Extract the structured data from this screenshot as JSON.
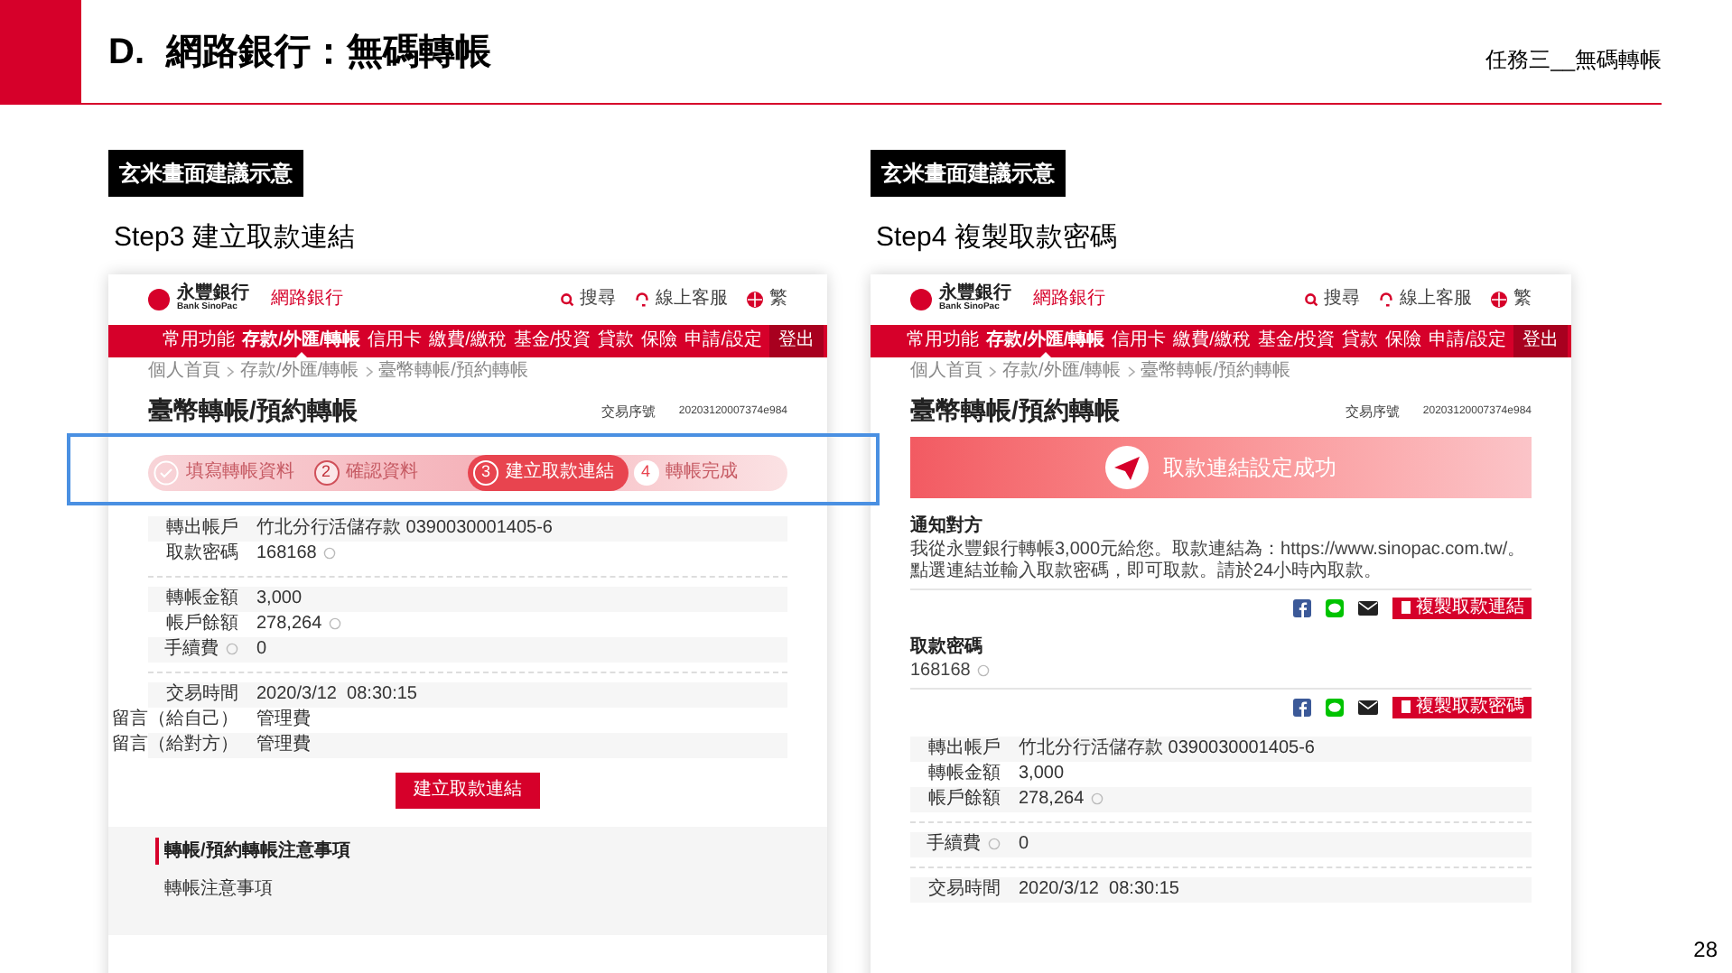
{
  "slide": {
    "section": "D.",
    "title": "網路銀行：無碼轉帳",
    "subtitle": "任務三__無碼轉帳",
    "page_number": "28"
  },
  "panels": [
    {
      "kind": "step3",
      "badge": "玄米畫面建議示意",
      "step_title": "Step3 建立取款連結",
      "highlighted": true,
      "screen": {
        "logo_name": "永豐銀行",
        "logo_en": "Bank SinoPac",
        "product": "網路銀行",
        "links": [
          {
            "kind": "search",
            "label": "搜尋"
          },
          {
            "kind": "support",
            "label": "線上客服"
          },
          {
            "kind": "language",
            "label": "繁"
          }
        ],
        "nav": [
          {
            "label": "常用功能",
            "selected": false
          },
          {
            "label": "存款/外匯/轉帳",
            "selected": true
          },
          {
            "label": "信用卡",
            "selected": false
          },
          {
            "label": "繳費/繳稅",
            "selected": false
          },
          {
            "label": "基金/投資",
            "selected": false
          },
          {
            "label": "貸款",
            "selected": false
          },
          {
            "label": "保險",
            "selected": false
          },
          {
            "label": "申請/設定",
            "selected": false
          }
        ],
        "logout": "登出",
        "breadcrumb": [
          "個人首頁",
          "存款/外匯/轉帳",
          "臺幣轉帳/預約轉帳"
        ],
        "page_title": "臺幣轉帳/預約轉帳",
        "serial_label": "交易序號",
        "serial": "20203120007374e984",
        "steps": [
          {
            "label": "填寫轉帳資料",
            "done": true,
            "selected": false
          },
          {
            "number": "2",
            "label": "確認資料",
            "done": false,
            "selected": false
          },
          {
            "number": "3",
            "label": "建立取款連結",
            "done": false,
            "selected": true
          },
          {
            "number": "4",
            "label": "轉帳完成",
            "done": false,
            "selected": false
          }
        ],
        "detail_groups": [
          [
            {
              "label": "轉出帳戶",
              "value": "竹北分行活儲存款 0390030001405-6"
            },
            {
              "label": "取款密碼",
              "value": "168168",
              "value_info": true
            }
          ],
          [
            {
              "label": "轉帳金額",
              "value": "3,000"
            },
            {
              "label": "帳戶餘額",
              "value": "278,264",
              "value_info": true
            },
            {
              "label": "手續費",
              "value": "0",
              "label_info": true
            }
          ],
          [
            {
              "label": "交易時間",
              "value": "2020/3/12  08:30:15"
            },
            {
              "label": "留言（給自己）",
              "value": "管理費"
            },
            {
              "label": "留言（給對方）",
              "value": "管理費"
            }
          ]
        ],
        "action_button": "建立取款連結",
        "notice_title": "轉帳/預約轉帳注意事項",
        "notice_text": "轉帳注意事項"
      }
    },
    {
      "kind": "step4",
      "badge": "玄米畫面建議示意",
      "step_title": "Step4 複製取款密碼",
      "screen": {
        "logo_name": "永豐銀行",
        "logo_en": "Bank SinoPac",
        "product": "網路銀行",
        "links": [
          {
            "kind": "search",
            "label": "搜尋"
          },
          {
            "kind": "support",
            "label": "線上客服"
          },
          {
            "kind": "language",
            "label": "繁"
          }
        ],
        "nav": [
          {
            "label": "常用功能",
            "selected": false
          },
          {
            "label": "存款/外匯/轉帳",
            "selected": true
          },
          {
            "label": "信用卡",
            "selected": false
          },
          {
            "label": "繳費/繳稅",
            "selected": false
          },
          {
            "label": "基金/投資",
            "selected": false
          },
          {
            "label": "貸款",
            "selected": false
          },
          {
            "label": "保險",
            "selected": false
          },
          {
            "label": "申請/設定",
            "selected": false
          }
        ],
        "logout": "登出",
        "breadcrumb": [
          "個人首頁",
          "存款/外匯/轉帳",
          "臺幣轉帳/預約轉帳"
        ],
        "page_title": "臺幣轉帳/預約轉帳",
        "serial_label": "交易序號",
        "serial": "20203120007374e984",
        "banner": "取款連結設定成功",
        "share_sections": [
          {
            "title": "通知對方",
            "text": "我從永豐銀行轉帳3,000元給您。取款連結為：https://www.sinopac.com.tw/。點選連結並輸入取款密碼，即可取款。請於24小時內取款。",
            "copy_button": "複製取款連結"
          },
          {
            "title": "取款密碼",
            "text": "168168",
            "info": true,
            "copy_button": "複製取款密碼"
          }
        ],
        "detail_groups": [
          [
            {
              "label": "轉出帳戶",
              "value": "竹北分行活儲存款 0390030001405-6"
            },
            {
              "label": "轉帳金額",
              "value": "3,000"
            },
            {
              "label": "帳戶餘額",
              "value": "278,264",
              "value_info": true
            }
          ],
          [
            {
              "label": "手續費",
              "value": "0",
              "label_info": true
            }
          ],
          [
            {
              "label": "交易時間",
              "value": "2020/3/12  08:30:15"
            }
          ]
        ]
      }
    }
  ]
}
